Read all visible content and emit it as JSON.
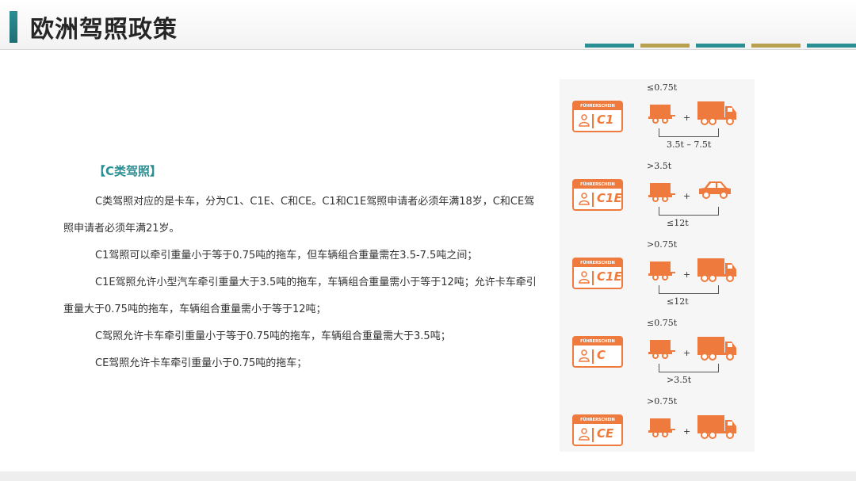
{
  "title": "欧洲驾照政策",
  "colors": {
    "accent": "#2a8f93",
    "orange": "#ef7a3d",
    "stripe_a": "#2a8f93",
    "stripe_b": "#b8a14e"
  },
  "section_title": "【C类驾照】",
  "paragraphs": [
    "C类驾照对应的是卡车，分为C1、C1E、C和CE。C1和C1E驾照申请者必须年满18岁，C和CE驾照申请者必须年满21岁。",
    "C1驾照可以牵引重量小于等于0.75吨的拖车，但车辆组合重量需在3.5-7.5吨之间；",
    "C1E驾照允许小型汽车牵引重量大于3.5吨的拖车，车辆组合重量需小于等于12吨；允许卡车牵引重量大于0.75吨的拖车，车辆组合重量需小于等于12吨；",
    "C驾照允许卡车牵引重量小于等于0.75吨的拖车，车辆组合重量需大于3.5吨；",
    "CE驾照允许卡车牵引重量小于0.75吨的拖车；"
  ],
  "licenses": [
    {
      "header": "FÜHRERSCHEIN",
      "code": "C1",
      "trailer_weight": "≤0.75t",
      "combined_weight": "3.5t – 7.5t",
      "towing": "truck-icon"
    },
    {
      "header": "FÜHRERSCHEIN",
      "code": "C1E",
      "trailer_weight": ">3.5t",
      "combined_weight": "≤12t",
      "towing": "car-icon"
    },
    {
      "header": "FÜHRERSCHEIN",
      "code": "C1E",
      "trailer_weight": ">0.75t",
      "combined_weight": "≤12t",
      "towing": "truck-icon"
    },
    {
      "header": "FÜHRERSCHEIN",
      "code": "C",
      "trailer_weight": "≤0.75t",
      "combined_weight": ">3.5t",
      "towing": "truck-icon"
    },
    {
      "header": "FÜHRERSCHEIN",
      "code": "CE",
      "trailer_weight": ">0.75t",
      "combined_weight": "",
      "towing": "truck-icon"
    }
  ]
}
